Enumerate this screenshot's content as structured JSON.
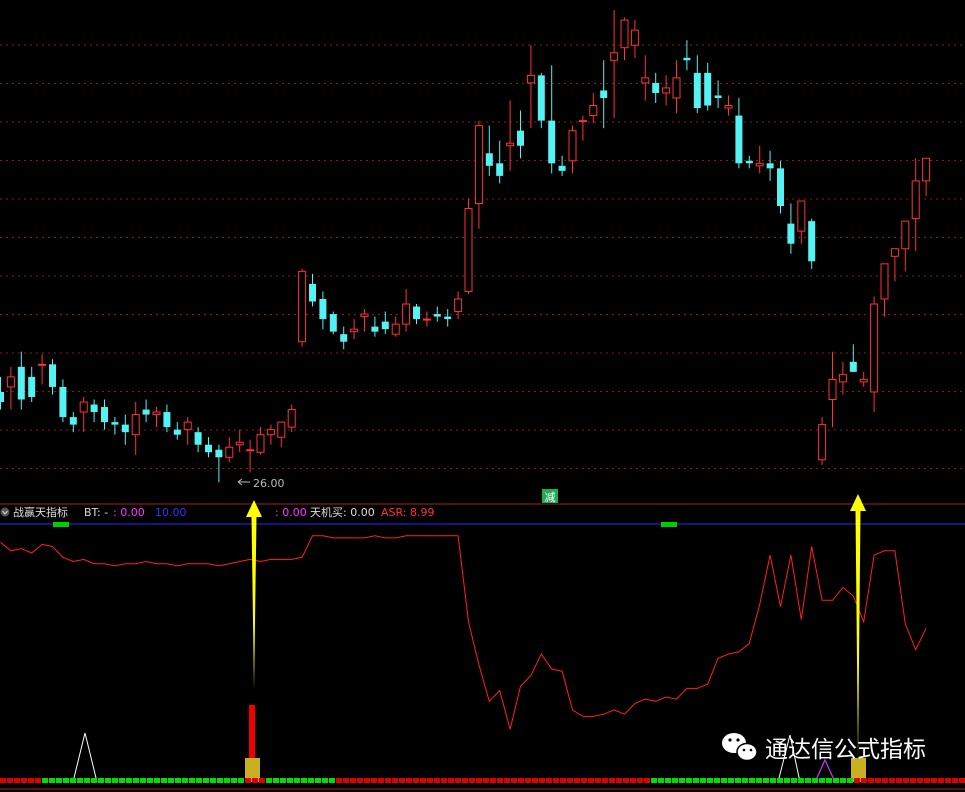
{
  "indicator": {
    "name": "战赢天指标",
    "bt_label": "BT: -",
    "v1": ": 0.00",
    "v2": "10.00",
    "v3": ": 0.00",
    "tianji_label": "天机买: 0.00",
    "asr_label": "ASR: 8.99",
    "color_name": "#dddddd",
    "color_v1": "#ff33ff",
    "color_v2": "#3333ff",
    "color_asr": "#ff3333"
  },
  "annotations": {
    "low_price": "26.00",
    "sell_marker": "减"
  },
  "watermark": {
    "text": "通达信公式指标",
    "icon": "wechat-icon"
  },
  "colors": {
    "up": "#ff3333",
    "down": "#54f2f2",
    "grid": "#8a1a1a",
    "line": "#ff2020",
    "arrow": "#ffff00",
    "green": "#00dd00"
  },
  "chart_data": [
    {
      "type": "candlestick",
      "ylim": [
        25.3,
        45.2
      ],
      "ohlc": [
        [
          29.6,
          30.2,
          28.9,
          29.2
        ],
        [
          29.8,
          30.6,
          28.9,
          30.2
        ],
        [
          30.6,
          31.2,
          28.9,
          29.3
        ],
        [
          30.2,
          30.6,
          29.2,
          29.4
        ],
        [
          30.7,
          31.1,
          29.9,
          30.7
        ],
        [
          30.7,
          30.9,
          29.5,
          29.8
        ],
        [
          29.8,
          30.1,
          28.4,
          28.6
        ],
        [
          28.6,
          28.8,
          28.0,
          28.3
        ],
        [
          28.8,
          29.4,
          28.0,
          29.2
        ],
        [
          29.1,
          29.3,
          28.4,
          28.8
        ],
        [
          29.0,
          29.3,
          28.1,
          28.4
        ],
        [
          28.4,
          28.6,
          27.9,
          28.3
        ],
        [
          28.3,
          28.7,
          27.5,
          28.0
        ],
        [
          27.9,
          29.2,
          27.1,
          28.7
        ],
        [
          28.9,
          29.3,
          28.4,
          28.7
        ],
        [
          28.7,
          29.0,
          28.2,
          28.8
        ],
        [
          28.8,
          29.1,
          28.0,
          28.2
        ],
        [
          28.1,
          28.4,
          27.7,
          27.9
        ],
        [
          28.1,
          28.6,
          27.5,
          28.4
        ],
        [
          28.0,
          28.2,
          27.2,
          27.5
        ],
        [
          27.5,
          27.8,
          27.0,
          27.2
        ],
        [
          27.3,
          27.5,
          26.0,
          27.0
        ],
        [
          27.0,
          27.8,
          26.8,
          27.4
        ],
        [
          27.5,
          28.1,
          27.2,
          27.6
        ],
        [
          27.3,
          27.7,
          26.4,
          27.3
        ],
        [
          27.2,
          28.2,
          27.1,
          27.9
        ],
        [
          27.9,
          28.3,
          27.5,
          28.1
        ],
        [
          27.8,
          28.3,
          27.4,
          28.4
        ],
        [
          28.2,
          29.1,
          28.0,
          28.9
        ],
        [
          31.6,
          34.5,
          31.4,
          34.4
        ],
        [
          33.9,
          34.3,
          33.0,
          33.2
        ],
        [
          33.3,
          33.6,
          32.1,
          32.5
        ],
        [
          32.7,
          32.8,
          31.9,
          32.0
        ],
        [
          31.9,
          32.2,
          31.3,
          31.6
        ],
        [
          32.0,
          32.5,
          31.7,
          32.1
        ],
        [
          32.6,
          32.9,
          32.0,
          32.7
        ],
        [
          32.2,
          32.6,
          31.8,
          32.0
        ],
        [
          32.4,
          32.8,
          31.9,
          32.1
        ],
        [
          31.9,
          32.6,
          31.8,
          32.3
        ],
        [
          32.3,
          33.7,
          32.0,
          33.1
        ],
        [
          33.0,
          33.1,
          32.3,
          32.5
        ],
        [
          32.5,
          32.8,
          32.2,
          32.5
        ],
        [
          32.7,
          33.0,
          32.4,
          32.6
        ],
        [
          32.6,
          32.9,
          32.2,
          32.5
        ],
        [
          32.8,
          33.6,
          32.5,
          33.3
        ],
        [
          33.6,
          37.3,
          33.5,
          36.9
        ],
        [
          37.1,
          40.4,
          36.1,
          40.2
        ],
        [
          39.1,
          40.2,
          38.2,
          38.6
        ],
        [
          38.7,
          39.6,
          37.9,
          38.2
        ],
        [
          39.4,
          41.2,
          38.4,
          39.5
        ],
        [
          40.0,
          40.8,
          38.9,
          39.4
        ],
        [
          41.9,
          43.4,
          40.1,
          42.2
        ],
        [
          42.2,
          42.3,
          40.1,
          40.4
        ],
        [
          40.4,
          42.6,
          38.3,
          38.7
        ],
        [
          38.6,
          39.0,
          38.2,
          38.4
        ],
        [
          38.8,
          40.2,
          38.3,
          40.0
        ],
        [
          40.4,
          40.6,
          39.6,
          40.4
        ],
        [
          40.6,
          41.5,
          40.3,
          41.0
        ],
        [
          41.6,
          42.8,
          40.1,
          41.3
        ],
        [
          42.8,
          44.8,
          40.5,
          43.1
        ],
        [
          43.3,
          44.5,
          42.8,
          44.4
        ],
        [
          43.4,
          44.4,
          42.9,
          44.0
        ],
        [
          41.9,
          43.0,
          41.2,
          42.1
        ],
        [
          41.9,
          42.3,
          41.1,
          41.5
        ],
        [
          41.5,
          42.2,
          41.0,
          41.7
        ],
        [
          41.3,
          42.8,
          40.7,
          42.1
        ],
        [
          42.9,
          43.6,
          42.4,
          42.8
        ],
        [
          42.3,
          43.0,
          40.7,
          40.9
        ],
        [
          42.3,
          42.7,
          40.8,
          41.0
        ],
        [
          41.4,
          42.0,
          40.9,
          41.3
        ],
        [
          40.9,
          41.4,
          40.6,
          41.0
        ],
        [
          40.6,
          41.3,
          38.5,
          38.7
        ],
        [
          38.8,
          39.0,
          38.5,
          38.7
        ],
        [
          38.6,
          39.4,
          38.3,
          38.7
        ],
        [
          38.7,
          39.2,
          38.0,
          38.5
        ],
        [
          38.5,
          38.8,
          36.7,
          37.0
        ],
        [
          36.3,
          37.1,
          35.1,
          35.5
        ],
        [
          36.0,
          37.0,
          35.5,
          37.2
        ],
        [
          36.4,
          36.5,
          34.5,
          34.8
        ],
        [
          26.9,
          28.6,
          26.7,
          28.3
        ],
        [
          29.3,
          31.2,
          28.2,
          30.1
        ],
        [
          30.0,
          30.8,
          29.5,
          30.3
        ],
        [
          30.8,
          31.5,
          30.4,
          30.4
        ],
        [
          30.0,
          30.4,
          29.8,
          30.1
        ],
        [
          29.6,
          33.4,
          28.8,
          33.1
        ],
        [
          33.3,
          34.7,
          32.6,
          34.7
        ],
        [
          35.0,
          35.3,
          34.0,
          35.3
        ],
        [
          35.3,
          36.4,
          34.4,
          36.4
        ],
        [
          36.5,
          38.9,
          35.2,
          38.0
        ],
        [
          38.0,
          38.6,
          37.4,
          38.9
        ]
      ]
    },
    {
      "type": "line",
      "ylim": [
        0,
        100
      ],
      "series": [
        {
          "values": [
            92,
            88,
            89,
            87,
            91,
            90,
            85,
            83,
            84,
            82,
            82,
            81,
            82,
            82,
            83,
            82,
            82,
            81,
            82,
            82,
            82,
            81,
            82,
            83,
            84,
            83,
            84,
            84,
            84,
            85,
            95,
            95,
            94,
            94,
            94,
            94,
            95,
            94,
            94,
            95,
            95,
            95,
            95,
            95,
            95,
            55,
            35,
            18,
            23,
            5,
            25,
            30,
            40,
            33,
            32,
            14,
            11,
            11,
            12,
            14,
            12,
            17,
            19,
            18,
            20,
            19,
            24,
            24,
            26,
            38,
            40,
            41,
            45,
            63,
            86,
            62,
            86,
            56,
            90,
            65,
            65,
            71,
            67,
            55,
            86,
            88,
            88,
            54,
            42,
            52
          ]
        }
      ]
    }
  ]
}
